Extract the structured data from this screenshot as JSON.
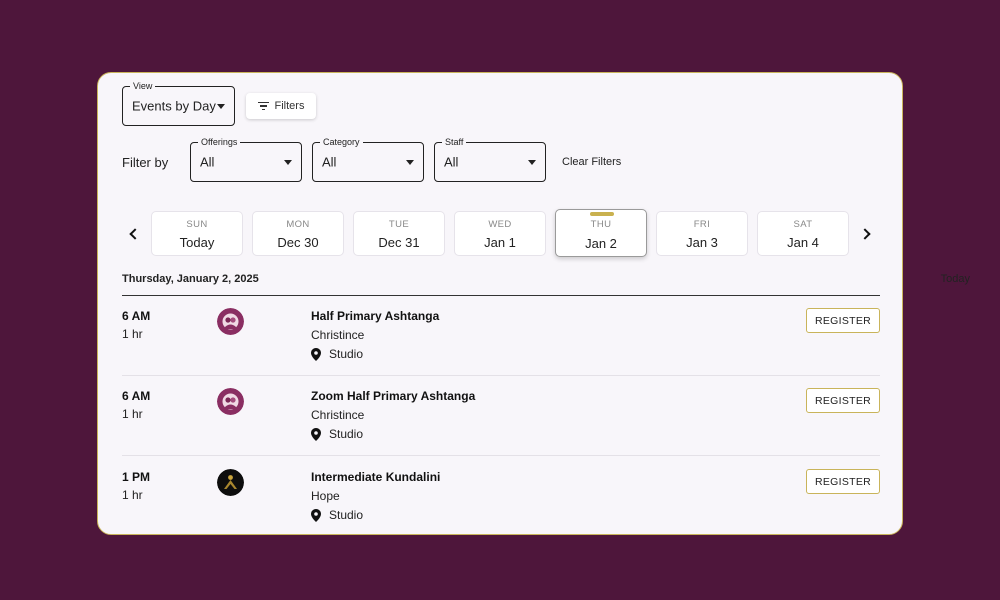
{
  "view": {
    "legend": "View",
    "value": "Events by Day"
  },
  "filters_button": {
    "label": "Filters"
  },
  "filter_by_label": "Filter by",
  "selects": [
    {
      "legend": "Offerings",
      "value": "All"
    },
    {
      "legend": "Category",
      "value": "All"
    },
    {
      "legend": "Staff",
      "value": "All"
    }
  ],
  "clear_filters": "Clear Filters",
  "days": [
    {
      "dow": "SUN",
      "date": "Today"
    },
    {
      "dow": "MON",
      "date": "Dec 30"
    },
    {
      "dow": "TUE",
      "date": "Dec 31"
    },
    {
      "dow": "WED",
      "date": "Jan 1"
    },
    {
      "dow": "THU",
      "date": "Jan 2",
      "selected": true
    },
    {
      "dow": "FRI",
      "date": "Jan 3"
    },
    {
      "dow": "SAT",
      "date": "Jan 4"
    }
  ],
  "date_heading": "Thursday, January 2, 2025",
  "today_link": "Today",
  "events": [
    {
      "time": "6 AM",
      "duration": "1 hr",
      "title": "Half Primary Ashtanga",
      "instructor": "Christince",
      "location": "Studio",
      "register_label": "REGISTER",
      "avatar": "purple-portrait"
    },
    {
      "time": "6 AM",
      "duration": "1 hr",
      "title": "Zoom Half Primary Ashtanga",
      "instructor": "Christince",
      "location": "Studio",
      "register_label": "REGISTER",
      "avatar": "purple-portrait"
    },
    {
      "time": "1 PM",
      "duration": "1 hr",
      "title": "Intermediate Kundalini",
      "instructor": "Hope",
      "location": "Studio",
      "register_label": "REGISTER",
      "avatar": "dark-yoga-pose"
    }
  ],
  "colors": {
    "background": "#4e163b",
    "card": "#f8f6fa",
    "accent_gold": "#c9b45a",
    "avatar_purple": "#8a2e62"
  },
  "icons": {
    "filter": "filter-lines-icon",
    "location": "map-pin-icon",
    "prev": "chevron-left-icon",
    "next": "chevron-right-icon",
    "dropdown": "caret-down-icon"
  }
}
